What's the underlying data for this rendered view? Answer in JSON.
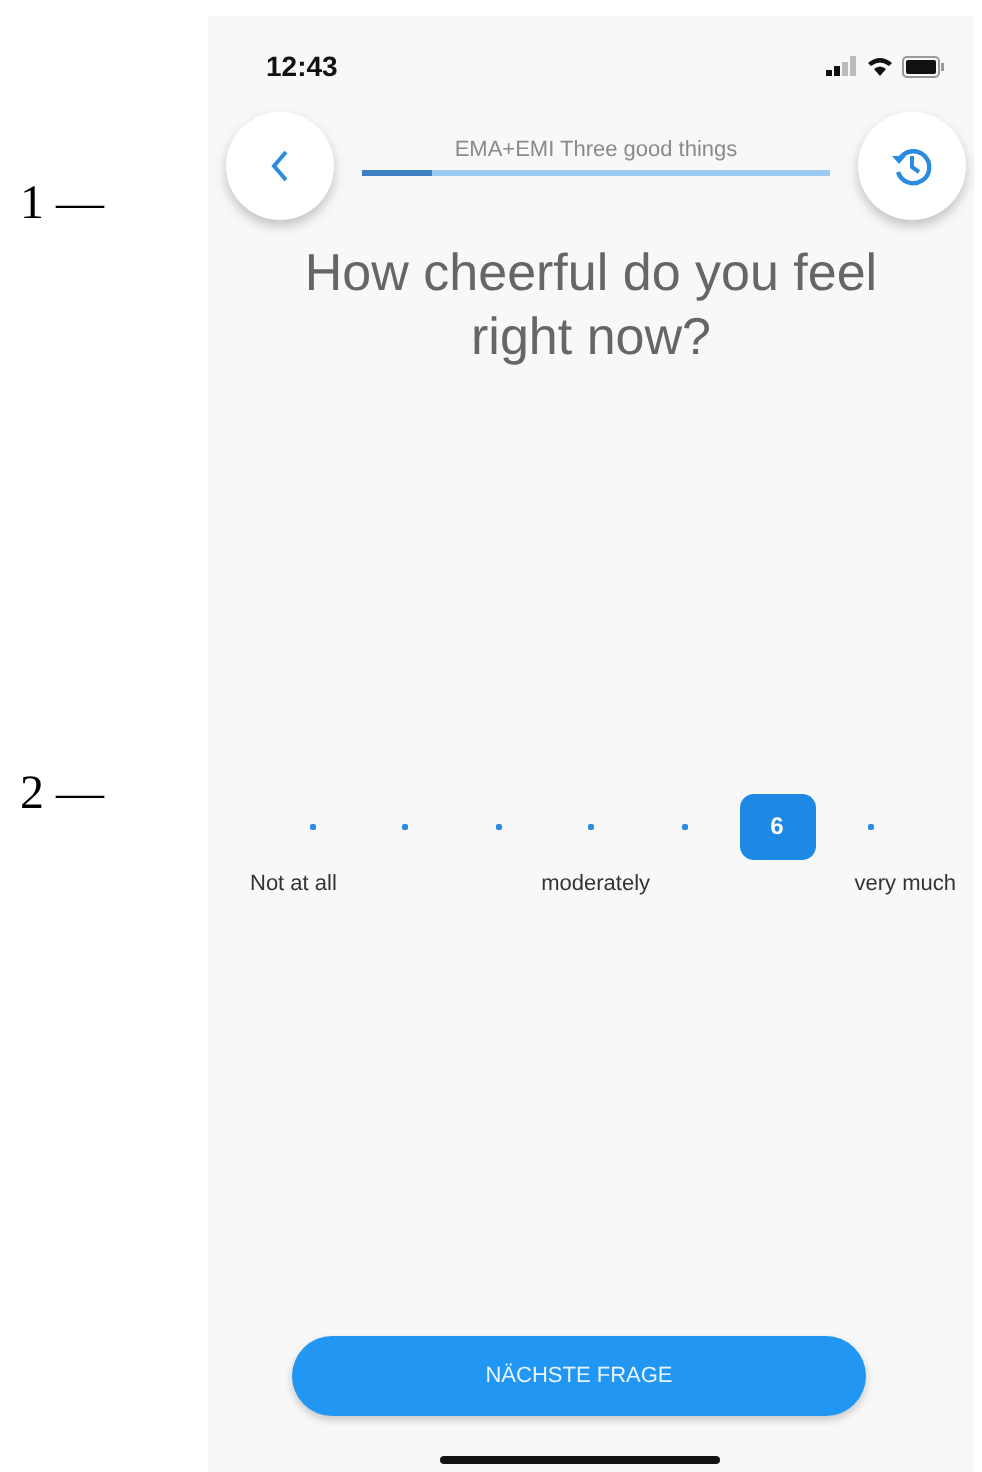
{
  "annotations": [
    {
      "label": "1 —"
    },
    {
      "label": "2 —"
    }
  ],
  "status_bar": {
    "time": "12:43"
  },
  "header": {
    "title": "EMA+EMI Three good things",
    "level": 0.15
  },
  "question": "How cheerful do you feel right now?",
  "scale": {
    "options": [
      {
        "selected": false
      },
      {
        "selected": false
      },
      {
        "selected": false
      },
      {
        "selected": false
      },
      {
        "selected": false
      },
      {
        "selected": true,
        "value": "6"
      },
      {
        "selected": false
      }
    ],
    "labels": [
      "Not at all",
      "moderately",
      "very much"
    ]
  },
  "next_button": {
    "label": "NÄCHSTE FRAGE"
  }
}
